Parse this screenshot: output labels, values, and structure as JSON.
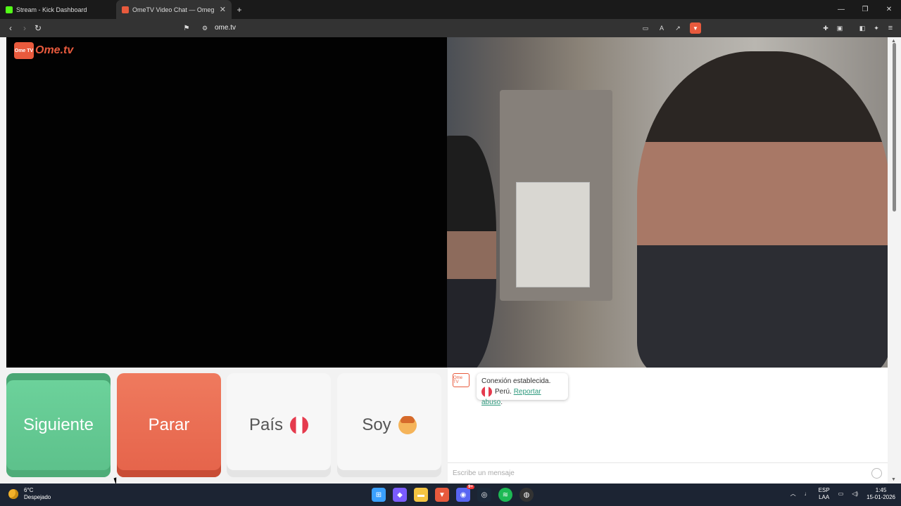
{
  "browser": {
    "tabs": [
      {
        "title": "Stream - Kick Dashboard",
        "active": false,
        "color": "#53fc18"
      },
      {
        "title": "OmeTV Video Chat — Omeg",
        "active": true,
        "color": "#e85a3d"
      }
    ],
    "new_tab": "+",
    "url": "ome.tv",
    "window_controls": [
      "—",
      "❐",
      "✕"
    ]
  },
  "site": {
    "logo_badge": "Ome TV",
    "logo_text": "Ome.tv",
    "buttons": {
      "next": "Siguiente",
      "stop": "Parar",
      "country": "País",
      "gender": "Soy"
    },
    "chat": {
      "icon_text": "Ome TV",
      "status": "Conexión establecida.",
      "country": "Perú.",
      "report": "Reportar abuso",
      "report_suffix": ".",
      "placeholder": "Escribe un mensaje"
    }
  },
  "taskbar": {
    "temperature": "6°C",
    "weather": "Despejado",
    "language": "ESP",
    "layout": "LAA",
    "time": "1:45",
    "date": "15-01-2026",
    "discord_badge": "9+"
  },
  "colors": {
    "accent_green": "#5cc08a",
    "accent_red": "#e5634a",
    "brand": "#e85a3d",
    "link": "#2f9a7e"
  }
}
